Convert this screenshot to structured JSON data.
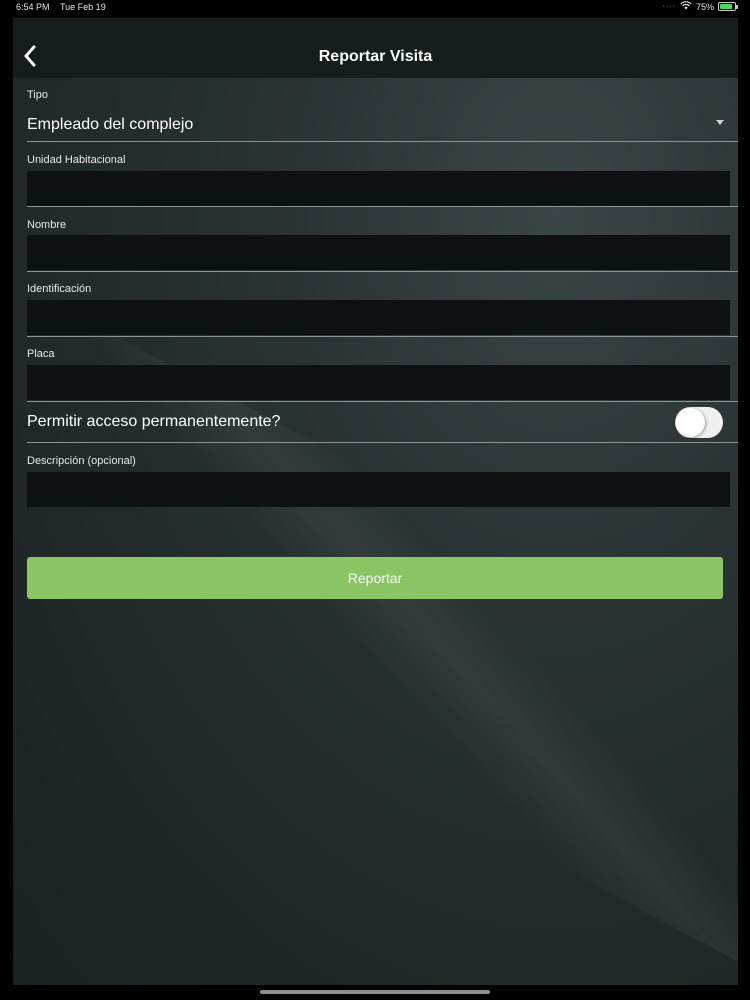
{
  "status_bar": {
    "time": "6:54 PM",
    "date": "Tue Feb 19",
    "battery": "75%",
    "icons": [
      "wifi-icon",
      "battery-icon"
    ]
  },
  "nav": {
    "title": "Reportar Visita",
    "back_icon": "chevron-left-icon"
  },
  "form": {
    "tipo": {
      "label": "Tipo",
      "value": "Empleado del complejo"
    },
    "unidad": {
      "label": "Unidad Habitacional",
      "value": ""
    },
    "nombre": {
      "label": "Nombre",
      "value": ""
    },
    "identificacion": {
      "label": "Identificación",
      "value": ""
    },
    "placa": {
      "label": "Placa",
      "value": ""
    },
    "permanente": {
      "label": "Permitir acceso permanentemente?",
      "checked": false
    },
    "descripcion": {
      "label": "Descripción (opcional)",
      "value": ""
    },
    "submit_label": "Reportar"
  },
  "colors": {
    "accent": "#8cc563",
    "navbar": "#161b1c",
    "input_bg": "#0d1112"
  }
}
